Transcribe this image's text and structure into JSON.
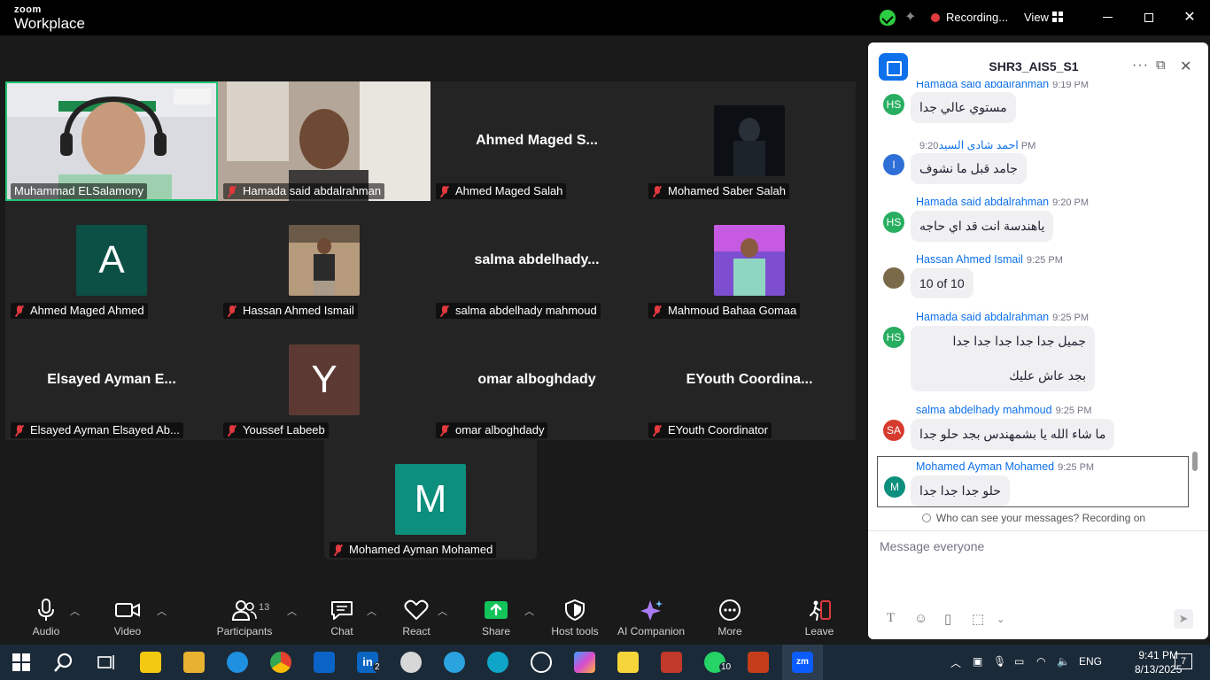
{
  "titlebar": {
    "brand_top": "zoom",
    "brand_bottom": "Workplace",
    "recording": "Recording...",
    "view": "View"
  },
  "participants_grid": [
    {
      "name": "Muhammad ELSalamony",
      "display": "video",
      "muted": false,
      "active": true
    },
    {
      "name": "Hamada said abdalrahman",
      "display": "video",
      "muted": true
    },
    {
      "name": "Ahmed Maged Salah",
      "big_name": "Ahmed Maged S...",
      "display": "name",
      "muted": true
    },
    {
      "name": "Mohamed Saber Salah",
      "display": "photo",
      "muted": true
    },
    {
      "name": "Ahmed Maged Ahmed",
      "letter": "A",
      "letter_color": "#0b4f45",
      "display": "letter",
      "muted": true
    },
    {
      "name": "Hassan Ahmed Ismail",
      "display": "photo",
      "muted": true
    },
    {
      "name": "salma abdelhady mahmoud",
      "big_name": "salma abdelhady...",
      "display": "name",
      "muted": true
    },
    {
      "name": "Mahmoud Bahaa Gomaa",
      "display": "photo",
      "muted": true
    },
    {
      "name": "Elsayed Ayman Elsayed Ab...",
      "big_name": "Elsayed Ayman E...",
      "display": "name",
      "muted": true
    },
    {
      "name": "Youssef Labeeb",
      "letter": "Y",
      "letter_color": "#5c3a33",
      "display": "letter",
      "muted": true
    },
    {
      "name": "omar alboghdady",
      "big_name": "omar alboghdady",
      "display": "name",
      "muted": true
    },
    {
      "name": "EYouth Coordinator",
      "big_name": "EYouth  Coordina...",
      "display": "name",
      "muted": true
    },
    {
      "name": "Mohamed Ayman Mohamed",
      "letter": "M",
      "letter_color": "#0d8f7d",
      "display": "letter",
      "muted": true
    }
  ],
  "toolbar": {
    "audio": "Audio",
    "video": "Video",
    "participants": "Participants",
    "participants_count": "13",
    "chat": "Chat",
    "react": "React",
    "share": "Share",
    "host_tools": "Host tools",
    "ai_companion": "AI Companion",
    "more": "More",
    "leave": "Leave"
  },
  "chat": {
    "title": "SHR3_AIS5_S1",
    "messages": [
      {
        "sender": "Hamada said abdalrahman",
        "time": "9:19 PM",
        "avatar": "HS",
        "avatar_color": "#27ae60",
        "text": "مستوي عالي جدا"
      },
      {
        "sender": "احمد شادى السيد",
        "time": "9:20 PM",
        "avatar": "I",
        "avatar_color": "#2d6fd6",
        "text": "جامد قبل ما نشوف"
      },
      {
        "sender": "Hamada said abdalrahman",
        "time": "9:20 PM",
        "avatar": "HS",
        "avatar_color": "#27ae60",
        "text": "ياهندسة انت قد اي حاجه"
      },
      {
        "sender": "Hassan Ahmed Ismail",
        "time": "9:25 PM",
        "avatar": "",
        "avatar_color": "#7a6a4a",
        "text": "10 of 10"
      },
      {
        "sender": "Hamada said abdalrahman",
        "time": "9:25 PM",
        "avatar": "HS",
        "avatar_color": "#27ae60",
        "text": "جميل جدا جدا جدا جدا جدا",
        "text2": "بجد عاش عليك"
      },
      {
        "sender": "salma abdelhady mahmoud",
        "time": "9:25 PM",
        "avatar": "SA",
        "avatar_color": "#d63b2e",
        "text": "ما شاء الله يا بشمهندس بجد حلو جدا"
      },
      {
        "sender": "Mohamed Ayman Mohamed",
        "time": "9:25 PM",
        "avatar": "M",
        "avatar_color": "#0d8f7d",
        "text": "حلو جدا جدا جدا"
      }
    ],
    "visibility_notice": "Who can see your messages? Recording on",
    "input_placeholder": "Message everyone"
  },
  "taskbar": {
    "lang": "ENG",
    "time": "9:41 PM",
    "date": "8/13/2025",
    "notifications": "7",
    "linkedin_badge": "2",
    "whatsapp_badge": "10"
  }
}
